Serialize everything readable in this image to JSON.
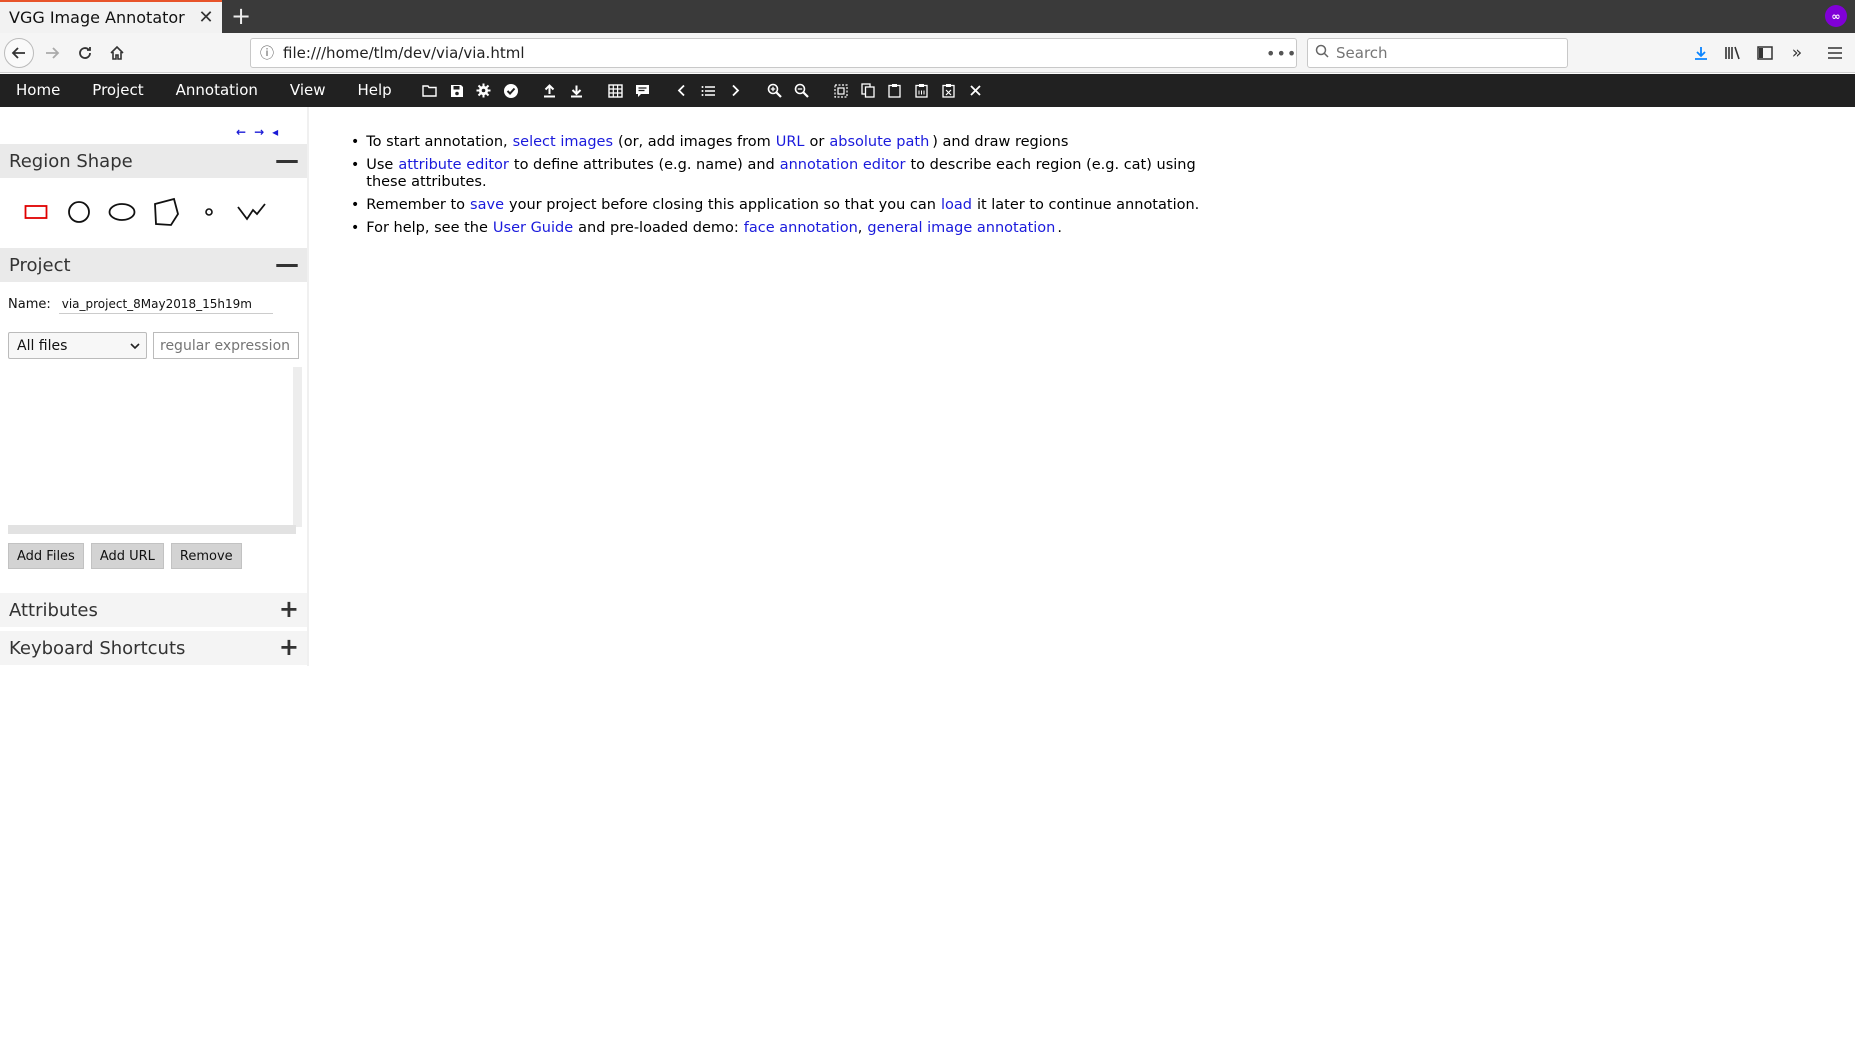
{
  "browser": {
    "tab_title": "VGG Image Annotator",
    "url": "file:///home/tlm/dev/via/via.html",
    "search_placeholder": "Search"
  },
  "via_menu": {
    "items": [
      "Home",
      "Project",
      "Annotation",
      "View",
      "Help"
    ]
  },
  "toolbar_icons": [
    "open-folder-icon",
    "save-icon",
    "settings-icon",
    "check-icon",
    "upload-icon",
    "download-icon",
    "grid-icon",
    "comment-icon",
    "previous-icon",
    "list-icon",
    "next-icon",
    "zoom-in-icon",
    "zoom-out-icon",
    "select-all-icon",
    "copy-icon",
    "paste-icon",
    "paste-multi-icon",
    "delete-region-icon",
    "close-icon"
  ],
  "sidebar": {
    "nav_arrows": [
      "←",
      "→",
      "◂"
    ],
    "region_shape": {
      "title": "Region Shape",
      "toggle": "—",
      "shapes": [
        "rectangle",
        "circle",
        "ellipse",
        "polygon",
        "point",
        "polyline"
      ],
      "selected": "rectangle",
      "selected_color": "#e00000"
    },
    "project": {
      "title": "Project",
      "toggle": "—",
      "name_label": "Name:",
      "name_value": "via_project_8May2018_15h19m",
      "filter_selected": "All files",
      "filter_placeholder": "regular expression",
      "buttons": {
        "add_files": "Add Files",
        "add_url": "Add URL",
        "remove": "Remove"
      }
    },
    "attributes": {
      "title": "Attributes",
      "toggle": "+"
    },
    "keyboard_shortcuts": {
      "title": "Keyboard Shortcuts",
      "toggle": "+"
    }
  },
  "instructions": {
    "b1": {
      "t1": "To start annotation,",
      "l1": "select images",
      "t2": "(or, add images from",
      "l2": "URL",
      "t3": "or",
      "l3": "absolute path",
      "t4": ") and draw regions"
    },
    "b2": {
      "t1": "Use",
      "l1": "attribute editor",
      "t2": "to define attributes (e.g. name) and",
      "l2": "annotation editor",
      "t3": "to describe each region (e.g. cat) using these attributes."
    },
    "b3": {
      "t1": "Remember to",
      "l1": "save",
      "t2": "your project before closing this application so that you can",
      "l2": "load",
      "t3": "it later to continue annotation."
    },
    "b4": {
      "t1": "For help, see the",
      "l1": "User Guide",
      "t2": "and pre-loaded demo:",
      "l2": "face annotation",
      "t3": ",",
      "l3": "general image annotation",
      "t4": "."
    }
  },
  "colors": {
    "menubar": "#212121",
    "link": "#1a1adc",
    "panel_header": "#eaeaea"
  }
}
